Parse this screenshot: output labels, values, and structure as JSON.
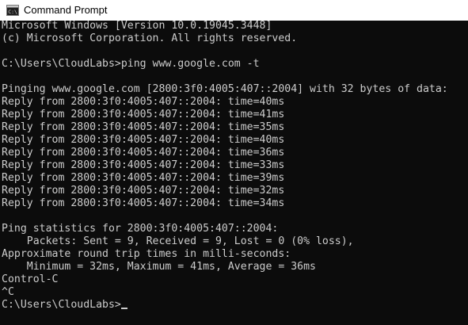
{
  "window": {
    "title": "Command Prompt",
    "icon": "command-prompt-icon"
  },
  "console": {
    "lines": [
      "Microsoft Windows [Version 10.0.19045.3448]",
      "(c) Microsoft Corporation. All rights reserved.",
      "",
      "C:\\Users\\CloudLabs>ping www.google.com -t",
      "",
      "Pinging www.google.com [2800:3f0:4005:407::2004] with 32 bytes of data:",
      "Reply from 2800:3f0:4005:407::2004: time=40ms",
      "Reply from 2800:3f0:4005:407::2004: time=41ms",
      "Reply from 2800:3f0:4005:407::2004: time=35ms",
      "Reply from 2800:3f0:4005:407::2004: time=40ms",
      "Reply from 2800:3f0:4005:407::2004: time=36ms",
      "Reply from 2800:3f0:4005:407::2004: time=33ms",
      "Reply from 2800:3f0:4005:407::2004: time=39ms",
      "Reply from 2800:3f0:4005:407::2004: time=32ms",
      "Reply from 2800:3f0:4005:407::2004: time=34ms",
      "",
      "Ping statistics for 2800:3f0:4005:407::2004:",
      "    Packets: Sent = 9, Received = 9, Lost = 0 (0% loss),",
      "Approximate round trip times in milli-seconds:",
      "    Minimum = 32ms, Maximum = 41ms, Average = 36ms",
      "Control-C",
      "^C",
      "C:\\Users\\CloudLabs>"
    ]
  },
  "colors": {
    "console_background": "#0c0c0c",
    "console_text": "#cccccc",
    "titlebar_background": "#ffffff"
  }
}
